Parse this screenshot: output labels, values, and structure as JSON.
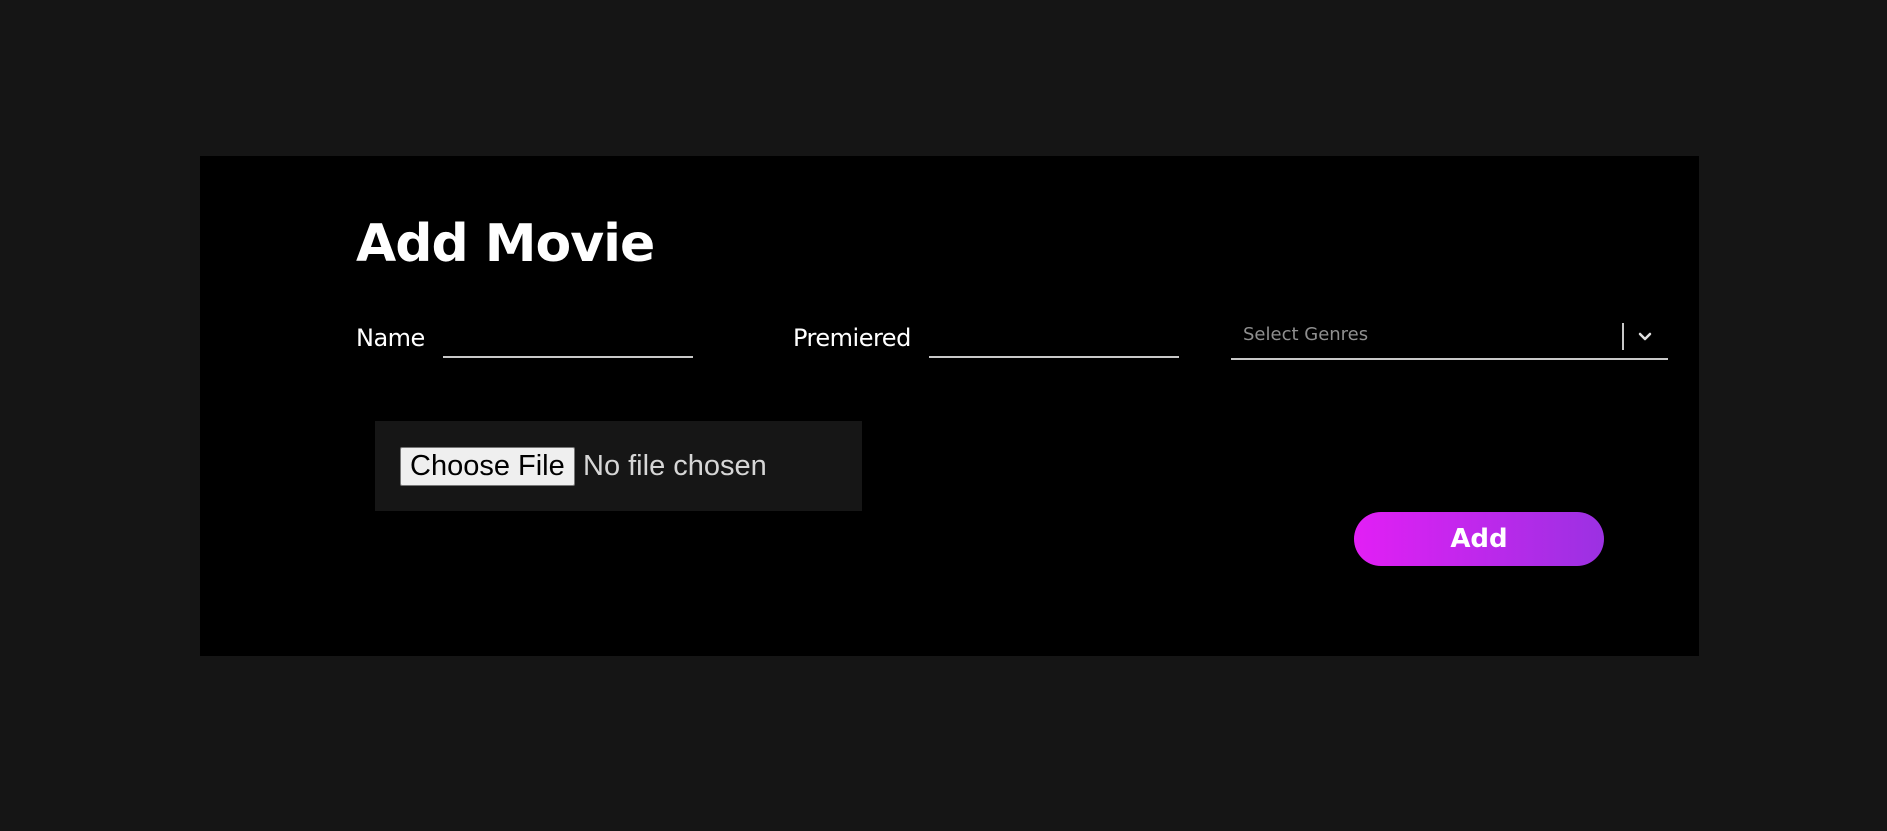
{
  "form": {
    "title": "Add Movie",
    "name": {
      "label": "Name",
      "value": ""
    },
    "premiered": {
      "label": "Premiered",
      "value": ""
    },
    "genres": {
      "placeholder": "Select Genres",
      "icon": "chevron-down-icon"
    },
    "file": {
      "button_label": "Choose File",
      "status": "No file chosen"
    },
    "submit_label": "Add"
  },
  "colors": {
    "page_background": "#151515",
    "panel_background": "#000000",
    "button_gradient_start": "#e21ff5",
    "button_gradient_end": "#9b31e2"
  }
}
